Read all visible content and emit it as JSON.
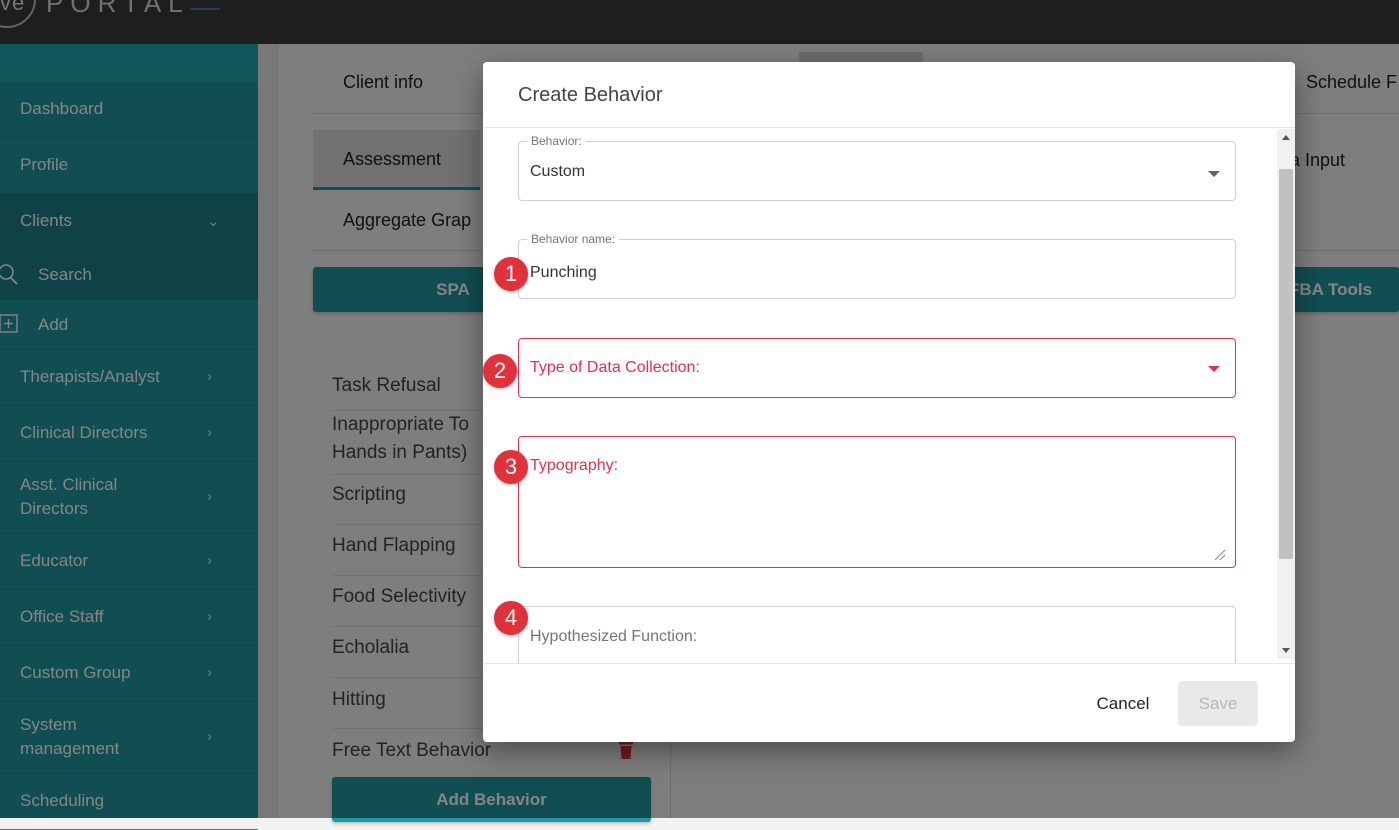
{
  "app": {
    "logo_prefix": "ve",
    "logo_text": "PORTAL"
  },
  "sidebar": {
    "items": [
      {
        "label": "Dashboard"
      },
      {
        "label": "Profile"
      },
      {
        "label": "Clients"
      },
      {
        "label": "Search"
      },
      {
        "label": "Add"
      },
      {
        "label": "Therapists/Analyst"
      },
      {
        "label": "Clinical Directors"
      },
      {
        "label": "Asst. Clinical",
        "label2": "Directors"
      },
      {
        "label": "Educator"
      },
      {
        "label": "Office Staff"
      },
      {
        "label": "Custom Group"
      },
      {
        "label": "System",
        "label2": "management"
      },
      {
        "label": "Scheduling"
      }
    ]
  },
  "tabs": {
    "client_info": "Client info",
    "schedule": "Schedule F",
    "assessment": "Assessment",
    "data_input": "a Input",
    "aggregate": "Aggregate Grap"
  },
  "buttons": {
    "spa": "SPA",
    "fba_tools": "FBA Tools",
    "add_behavior": "Add Behavior"
  },
  "behaviors": [
    {
      "label": "Task Refusal"
    },
    {
      "label": "Inappropriate To",
      "label2": "Hands in Pants)"
    },
    {
      "label": "Scripting"
    },
    {
      "label": "Hand Flapping"
    },
    {
      "label": "Food Selectivity"
    },
    {
      "label": "Echolalia"
    },
    {
      "label": "Hitting"
    },
    {
      "label": "Free Text Behavior"
    }
  ],
  "modal": {
    "title": "Create Behavior",
    "behavior_label": "Behavior:",
    "behavior_value": "Custom",
    "name_label": "Behavior name:",
    "name_value": "Punching",
    "data_collection_placeholder": "Type of Data Collection:",
    "typography_placeholder": "Typography:",
    "function_placeholder": "Hypothesized Function:",
    "cancel": "Cancel",
    "save": "Save"
  },
  "badges": [
    "1",
    "2",
    "3",
    "4"
  ],
  "colors": {
    "teal": "#21969e",
    "error": "#e0334c",
    "badge": "#e0323c",
    "topbar": "#3a3a3a"
  }
}
